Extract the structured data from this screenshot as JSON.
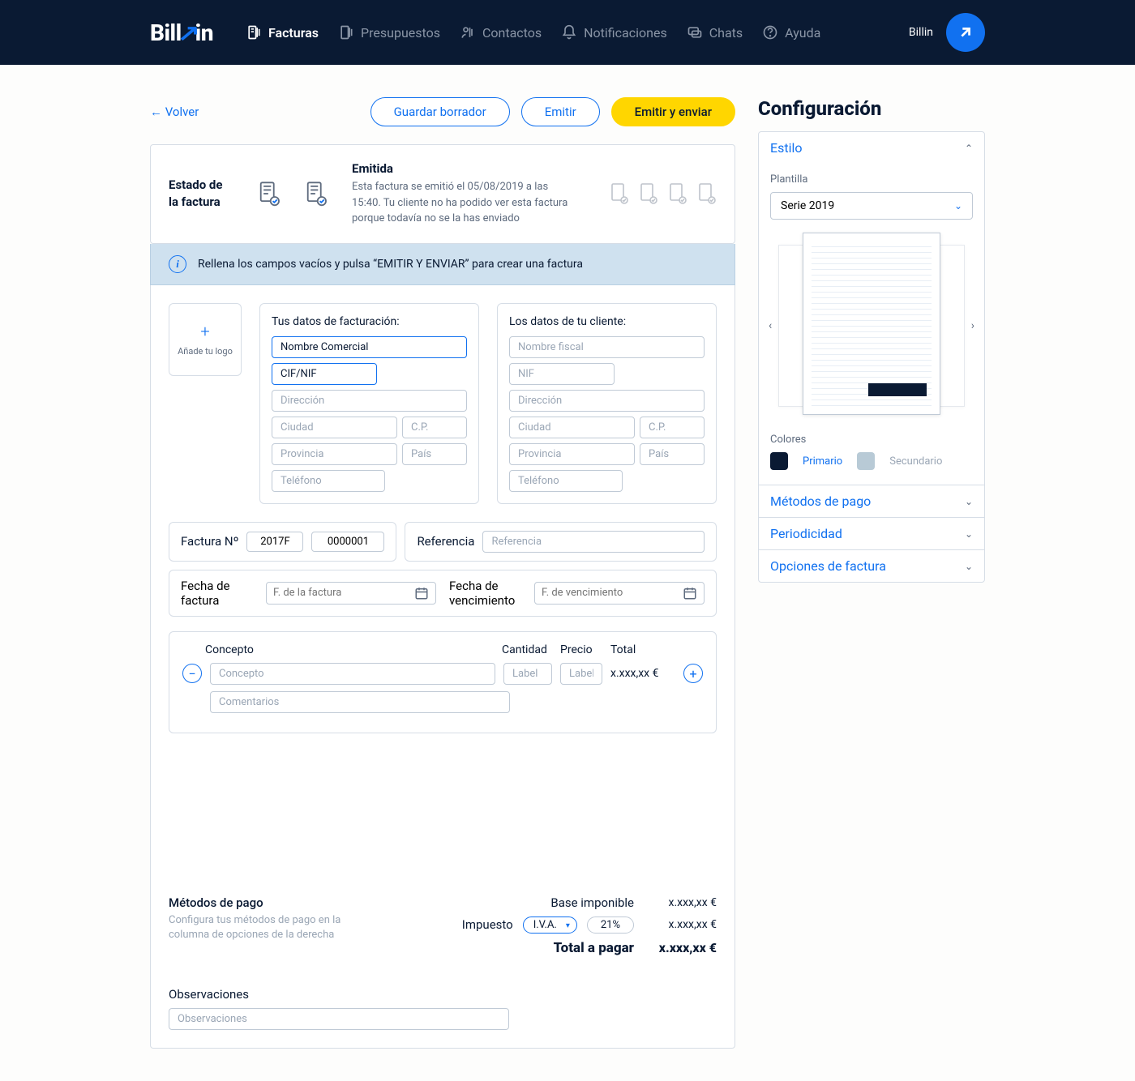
{
  "header": {
    "brand": "Billin",
    "nav": [
      "Facturas",
      "Presupuestos",
      "Contactos",
      "Notificaciones",
      "Chats",
      "Ayuda"
    ],
    "user_name": "Billin"
  },
  "actions": {
    "back": "←  Volver",
    "save_draft": "Guardar borrador",
    "emit": "Emitir",
    "emit_send": "Emitir y enviar"
  },
  "status": {
    "title": "Estado de la factura",
    "state_title": "Emitida",
    "state_desc": "Esta factura se emitió el 05/08/2019 a las 15:40. Tu cliente no ha podido ver esta factura porque todavía no se la has enviado"
  },
  "banner": "Rellena los campos vacíos y pulsa “EMITIR Y ENVIAR” para crear una factura",
  "logo_upload": "Añade tu logo",
  "your_data": {
    "title": "Tus datos de facturación:",
    "name": "Nombre Comercial",
    "tax_id": "CIF/NIF",
    "address_ph": "Dirección",
    "city_ph": "Ciudad",
    "zip_ph": "C.P.",
    "province_ph": "Provincia",
    "country_ph": "País",
    "phone_ph": "Teléfono"
  },
  "client_data": {
    "title": "Los datos de tu cliente:",
    "name_ph": "Nombre fiscal",
    "tax_id_ph": "NIF",
    "address_ph": "Dirección",
    "city_ph": "Ciudad",
    "zip_ph": "C.P.",
    "province_ph": "Provincia",
    "country_ph": "País",
    "phone_ph": "Teléfono"
  },
  "invoice_meta": {
    "number_label": "Factura Nº",
    "series": "2017F",
    "number": "0000001",
    "ref_label": "Referencia",
    "ref_ph": "Referencia",
    "date_label": "Fecha de factura",
    "date_ph": "F. de la factura",
    "due_label": "Fecha de vencimiento",
    "due_ph": "F. de vencimiento"
  },
  "concepts": {
    "head_concept": "Concepto",
    "head_qty": "Cantidad",
    "head_price": "Precio",
    "head_total": "Total",
    "concept_ph": "Concepto",
    "label_ph": "Label",
    "total_val": "x.xxx,xx €",
    "comment_ph": "Comentarios"
  },
  "payments": {
    "title": "Métodos de pago",
    "desc": "Configura tus métodos de pago en la columna de opciones de la derecha"
  },
  "totals": {
    "base_label": "Base imponible",
    "base_val": "x.xxx,xx €",
    "tax_label": "Impuesto",
    "tax_type": "I.V.A.",
    "tax_pct": "21%",
    "tax_val": "x.xxx,xx €",
    "grand_label": "Total a pagar",
    "grand_val": "x.xxx,xx €"
  },
  "obs": {
    "title": "Observaciones",
    "ph": "Observaciones"
  },
  "config": {
    "title": "Configuración",
    "style": "Estilo",
    "template_label": "Plantilla",
    "template_value": "Serie 2019",
    "colors_label": "Colores",
    "primary": "Primario",
    "secondary": "Secundario",
    "payment_methods": "Métodos de pago",
    "periodicity": "Periodicidad",
    "invoice_options": "Opciones de factura"
  }
}
